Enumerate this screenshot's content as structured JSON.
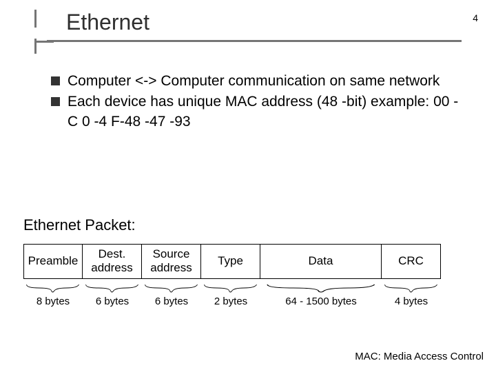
{
  "page_number": "4",
  "title": "Ethernet",
  "bullets": [
    "Computer <-> Computer communication on same network",
    "Each device has unique MAC address (48 -bit) example: 00 -C 0 -4 F-48 -47 -93"
  ],
  "section_label": "Ethernet Packet:",
  "packet": {
    "fields": [
      {
        "label": "Preamble",
        "size": "8 bytes"
      },
      {
        "label": "Dest. address",
        "size": "6 bytes"
      },
      {
        "label": "Source address",
        "size": "6 bytes"
      },
      {
        "label": "Type",
        "size": "2 bytes"
      },
      {
        "label": "Data",
        "size": "64 - 1500 bytes"
      },
      {
        "label": "CRC",
        "size": "4 bytes"
      }
    ]
  },
  "footer": "MAC: Media Access Control"
}
